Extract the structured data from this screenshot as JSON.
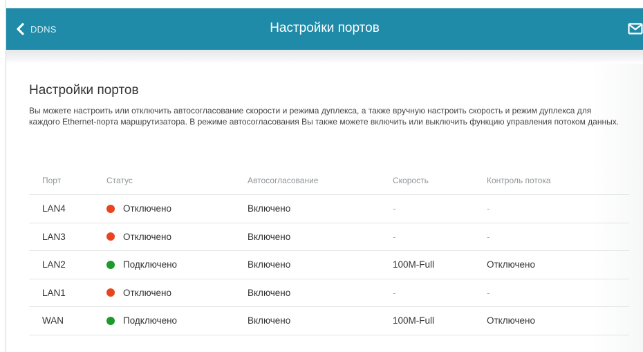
{
  "header": {
    "back_label": "DDNS",
    "title": "Настройки портов",
    "color": "#1f8ba8"
  },
  "main": {
    "title": "Настройки портов",
    "description": "Вы можете настроить или отключить автосогласование скорости и режима дуплекса, а также вручную настроить скорость и режим дуплекса для каждого Ethernet-порта маршрутизатора. В режиме автосогласования Вы также можете включить или выключить функцию управления потоком данных."
  },
  "table": {
    "columns": {
      "port": "Порт",
      "status": "Статус",
      "auto": "Автосогласование",
      "speed": "Скорость",
      "flow": "Контроль потока"
    },
    "status_colors": {
      "down": "#e8451f",
      "up": "#1d9a2b"
    },
    "rows": [
      {
        "port": "LAN4",
        "status": "Отключено",
        "auto": "Включено",
        "speed": "-",
        "flow": "-"
      },
      {
        "port": "LAN3",
        "status": "Отключено",
        "auto": "Включено",
        "speed": "-",
        "flow": "-"
      },
      {
        "port": "LAN2",
        "status": "Подключено",
        "auto": "Включено",
        "speed": "100M-Full",
        "flow": "Отключено"
      },
      {
        "port": "LAN1",
        "status": "Отключено",
        "auto": "Включено",
        "speed": "-",
        "flow": "-"
      },
      {
        "port": "WAN",
        "status": "Подключено",
        "auto": "Включено",
        "speed": "100M-Full",
        "flow": "Отключено"
      }
    ]
  },
  "icons": {
    "back": "chevron-left-icon",
    "mail": "mail-icon",
    "status_dot": "status-dot-icon"
  }
}
